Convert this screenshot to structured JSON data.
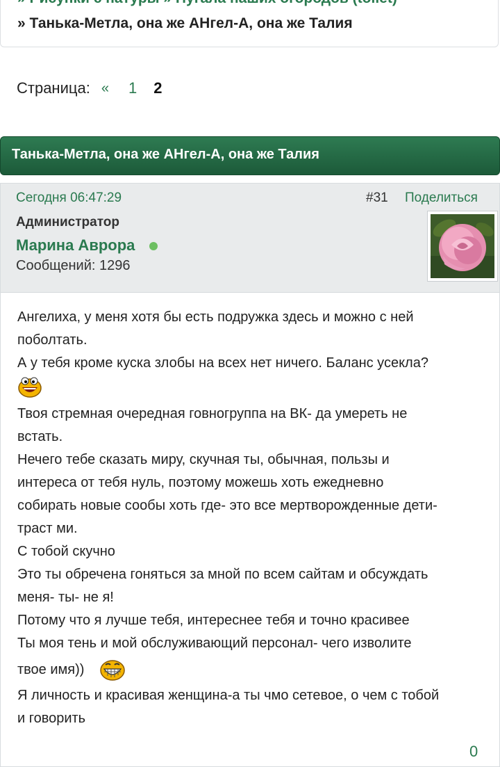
{
  "breadcrumb": {
    "line1": "» Рисунки с натуры » Пугала наших огородов (toilet)",
    "line2": "» Танька-Метла, она же АНгел-А, она же Талия"
  },
  "pagination": {
    "label": "Страница:",
    "prev": "«",
    "pages": [
      "1",
      "2"
    ],
    "current": "2"
  },
  "topic": {
    "title": "Танька-Метла, она же АНгел-А, она же Талия"
  },
  "post": {
    "date": "Сегодня 06:47:29",
    "number": "#31",
    "share": "Поделиться",
    "role": "Администратор",
    "author": "Марина Аврора",
    "messages": "Сообщений: 1296",
    "lines": [
      "Ангелиха, у меня хотя бы есть подружка здесь и можно с ней",
      "поболтать.",
      "А у тебя кроме куска злобы на всех нет ничего. Баланс усекла?",
      "Твоя стремная очередная говногруппа на ВК- да умереть не",
      "встать.",
      "Нечего тебе сказать миру, скучная ты, обычная, пользы и",
      "интереса от тебя нуль, поэтому можешь хоть ежедневно",
      "собирать новые сообы хоть где- это все мертворожденные дети-",
      "траст ми.",
      "С тобой скучно",
      "Это ты обречена гоняться за мной по всем сайтам и обсуждать",
      "меня- ты- не я!",
      "Потому что я лучше тебя, интереснее тебя и точно красивее",
      "Ты моя тень и мой обслуживающий персонал- чего изволите",
      "твое имя))",
      "Я личность и красивая женщина-а  ты чмо сетевое, о чем с тобой",
      "и говорить"
    ],
    "like_count": "0"
  },
  "colors": {
    "accent": "#2a7a4f",
    "header_bg": "#1f6040",
    "online": "#6dbf62"
  }
}
